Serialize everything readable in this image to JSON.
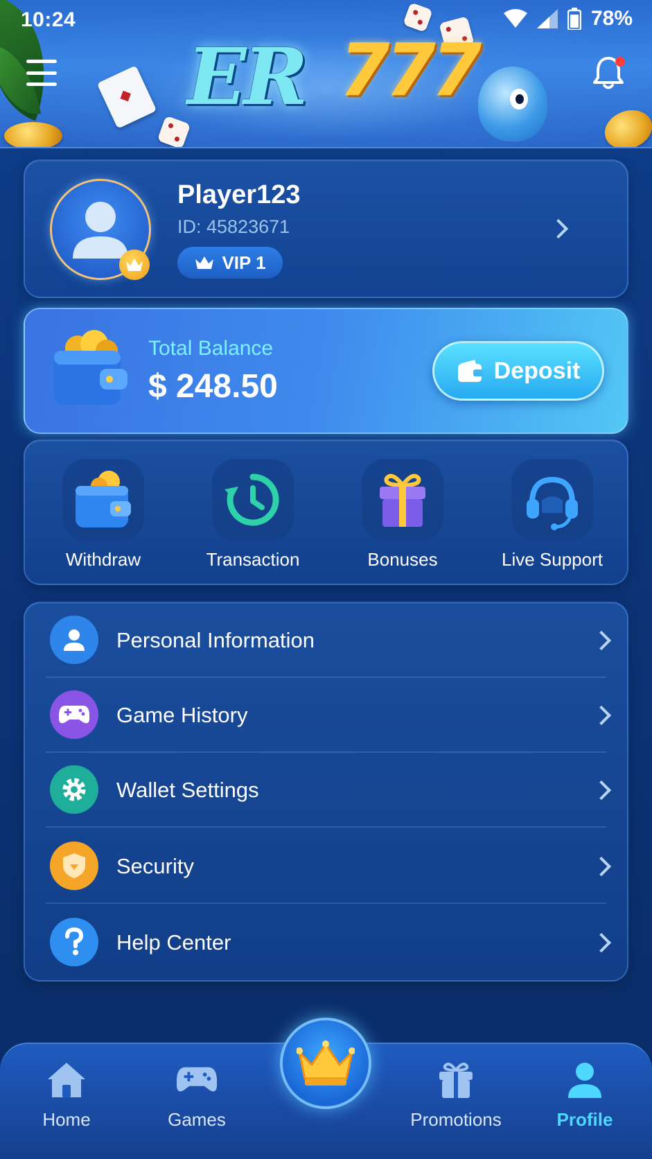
{
  "status_bar": {
    "time": "10:24",
    "battery": "78%"
  },
  "header": {
    "logo_text_er": "ER",
    "logo_text_777": "777"
  },
  "profile": {
    "username": "Player123",
    "user_id": "ID: 45823671",
    "vip_label": "VIP 1"
  },
  "balance": {
    "label": "Total Balance",
    "value": "$ 248.50",
    "deposit_label": "Deposit"
  },
  "quick_actions": [
    {
      "label": "Withdraw",
      "icon": "wallet-icon"
    },
    {
      "label": "Transaction",
      "icon": "history-clock-icon"
    },
    {
      "label": "Bonuses",
      "icon": "gift-icon"
    },
    {
      "label": "Live Support",
      "icon": "headset-icon"
    }
  ],
  "menu": [
    {
      "label": "Personal Information",
      "icon": "user-icon",
      "color": "#2f86ea"
    },
    {
      "label": "Game History",
      "icon": "gamepad-icon",
      "color": "#8a55e6"
    },
    {
      "label": "Wallet Settings",
      "icon": "gear-icon",
      "color": "#1fae9a"
    },
    {
      "label": "Security",
      "icon": "shield-icon",
      "color": "#f5a528"
    },
    {
      "label": "Help Center",
      "icon": "question-icon",
      "color": "#2f8ff0"
    }
  ],
  "bottom_nav": {
    "home": "Home",
    "games": "Games",
    "promotions": "Promotions",
    "profile": "Profile",
    "active": "Profile"
  },
  "colors": {
    "accent_cyan": "#4fd8ff",
    "notification_dot": "#ff3b3b",
    "gold": "#ffc93b"
  }
}
